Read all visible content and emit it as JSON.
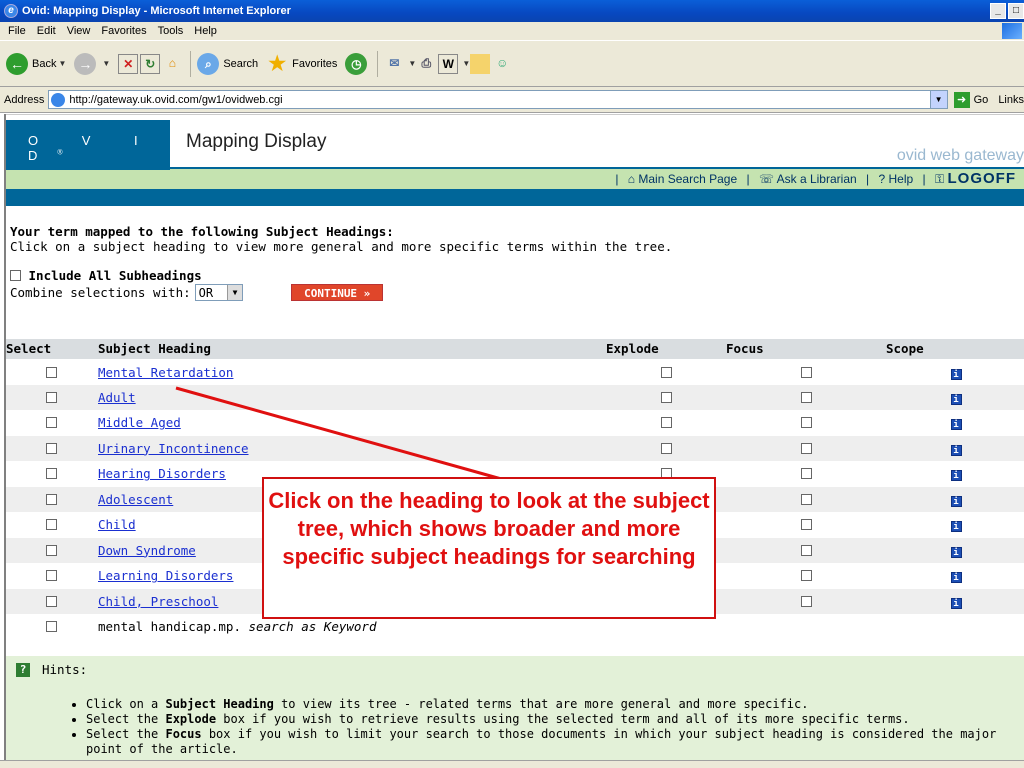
{
  "window": {
    "title": "Ovid: Mapping Display - Microsoft Internet Explorer"
  },
  "menu": [
    "File",
    "Edit",
    "View",
    "Favorites",
    "Tools",
    "Help"
  ],
  "toolbar": {
    "back": "Back",
    "search": "Search",
    "favorites": "Favorites"
  },
  "address": {
    "label": "Address",
    "url": "http://gateway.uk.ovid.com/gw1/ovidweb.cgi",
    "go": "Go",
    "links": "Links"
  },
  "header": {
    "logo": "O V I D",
    "logo_mark": "®",
    "title": "Mapping Display",
    "gateway": "ovid web gateway"
  },
  "nav": {
    "main_search": "Main Search Page",
    "ask_librarian": "Ask a Librarian",
    "help": "Help",
    "logoff": "LOGOFF"
  },
  "intro": {
    "heading": "Your term mapped to the following Subject Headings:",
    "instruction": "Click on a subject heading to view more general and more specific terms within the tree."
  },
  "options": {
    "include_subheadings": "Include All Subheadings",
    "combine_label": "Combine selections with:",
    "combine_value": "OR",
    "continue": "CONTINUE »"
  },
  "table": {
    "headers": {
      "select": "Select",
      "subject": "Subject Heading",
      "explode": "Explode",
      "focus": "Focus",
      "scope": "Scope"
    },
    "rows": [
      "Mental Retardation",
      "Adult",
      "Middle Aged",
      "Urinary Incontinence",
      "Hearing Disorders",
      "Adolescent",
      "Child",
      "Down Syndrome",
      "Learning Disorders",
      "Child, Preschool"
    ],
    "keyword_row": {
      "term": "mental handicap.mp.",
      "suffix": "search as Keyword"
    }
  },
  "hints": {
    "title": "Hints:",
    "items": [
      {
        "pre": "Click on a ",
        "bold": "Subject Heading",
        "post": " to view its tree - related terms that are more general and more specific."
      },
      {
        "pre": "Select the ",
        "bold": "Explode",
        "post": " box if you wish to retrieve results using the selected term and all of its more specific terms."
      },
      {
        "pre": "Select the ",
        "bold": "Focus",
        "post": " box if you wish to limit your search to those documents in which your subject heading is considered the major point of the article."
      }
    ]
  },
  "callout": {
    "text": "Click on the heading to look at the subject tree, which shows broader and more specific subject headings for searching"
  },
  "colors": {
    "ovid_blue": "#006699",
    "nav_green": "#c5e3b0",
    "callout_red": "#e01010"
  }
}
